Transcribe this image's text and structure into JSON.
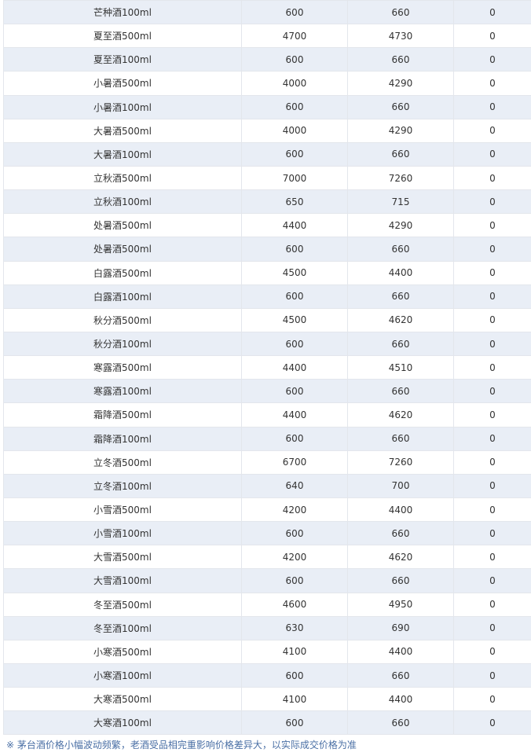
{
  "table": {
    "rows": [
      {
        "name": "芒种酒100ml",
        "a": "600",
        "b": "660",
        "c": "0"
      },
      {
        "name": "夏至酒500ml",
        "a": "4700",
        "b": "4730",
        "c": "0"
      },
      {
        "name": "夏至酒100ml",
        "a": "600",
        "b": "660",
        "c": "0"
      },
      {
        "name": "小暑酒500ml",
        "a": "4000",
        "b": "4290",
        "c": "0"
      },
      {
        "name": "小暑酒100ml",
        "a": "600",
        "b": "660",
        "c": "0"
      },
      {
        "name": "大暑酒500ml",
        "a": "4000",
        "b": "4290",
        "c": "0"
      },
      {
        "name": "大暑酒100ml",
        "a": "600",
        "b": "660",
        "c": "0"
      },
      {
        "name": "立秋酒500ml",
        "a": "7000",
        "b": "7260",
        "c": "0"
      },
      {
        "name": "立秋酒100ml",
        "a": "650",
        "b": "715",
        "c": "0"
      },
      {
        "name": "处暑酒500ml",
        "a": "4400",
        "b": "4290",
        "c": "0"
      },
      {
        "name": "处暑酒500ml",
        "a": "600",
        "b": "660",
        "c": "0"
      },
      {
        "name": "白露酒500ml",
        "a": "4500",
        "b": "4400",
        "c": "0"
      },
      {
        "name": "白露酒100ml",
        "a": "600",
        "b": "660",
        "c": "0"
      },
      {
        "name": "秋分酒500ml",
        "a": "4500",
        "b": "4620",
        "c": "0"
      },
      {
        "name": "秋分酒100ml",
        "a": "600",
        "b": "660",
        "c": "0"
      },
      {
        "name": "寒露酒500ml",
        "a": "4400",
        "b": "4510",
        "c": "0"
      },
      {
        "name": "寒露酒100ml",
        "a": "600",
        "b": "660",
        "c": "0"
      },
      {
        "name": "霜降酒500ml",
        "a": "4400",
        "b": "4620",
        "c": "0"
      },
      {
        "name": "霜降酒100ml",
        "a": "600",
        "b": "660",
        "c": "0"
      },
      {
        "name": "立冬酒500ml",
        "a": "6700",
        "b": "7260",
        "c": "0"
      },
      {
        "name": "立冬酒100ml",
        "a": "640",
        "b": "700",
        "c": "0"
      },
      {
        "name": "小雪酒500ml",
        "a": "4200",
        "b": "4400",
        "c": "0"
      },
      {
        "name": "小雪酒100ml",
        "a": "600",
        "b": "660",
        "c": "0"
      },
      {
        "name": "大雪酒500ml",
        "a": "4200",
        "b": "4620",
        "c": "0"
      },
      {
        "name": "大雪酒100ml",
        "a": "600",
        "b": "660",
        "c": "0"
      },
      {
        "name": "冬至酒500ml",
        "a": "4600",
        "b": "4950",
        "c": "0"
      },
      {
        "name": "冬至酒100ml",
        "a": "630",
        "b": "690",
        "c": "0"
      },
      {
        "name": "小寒酒500ml",
        "a": "4100",
        "b": "4400",
        "c": "0"
      },
      {
        "name": "小寒酒100ml",
        "a": "600",
        "b": "660",
        "c": "0"
      },
      {
        "name": "大寒酒500ml",
        "a": "4100",
        "b": "4400",
        "c": "0"
      },
      {
        "name": "大寒酒100ml",
        "a": "600",
        "b": "660",
        "c": "0"
      }
    ]
  },
  "note": "※ 茅台酒价格小幅波动频繁，老酒受品相完重影响价格差异大，以实际成交价格为准",
  "colors": {
    "row_alt": "#e9eef6",
    "border": "#e3e6ec",
    "note_text": "#4a6fa5"
  }
}
